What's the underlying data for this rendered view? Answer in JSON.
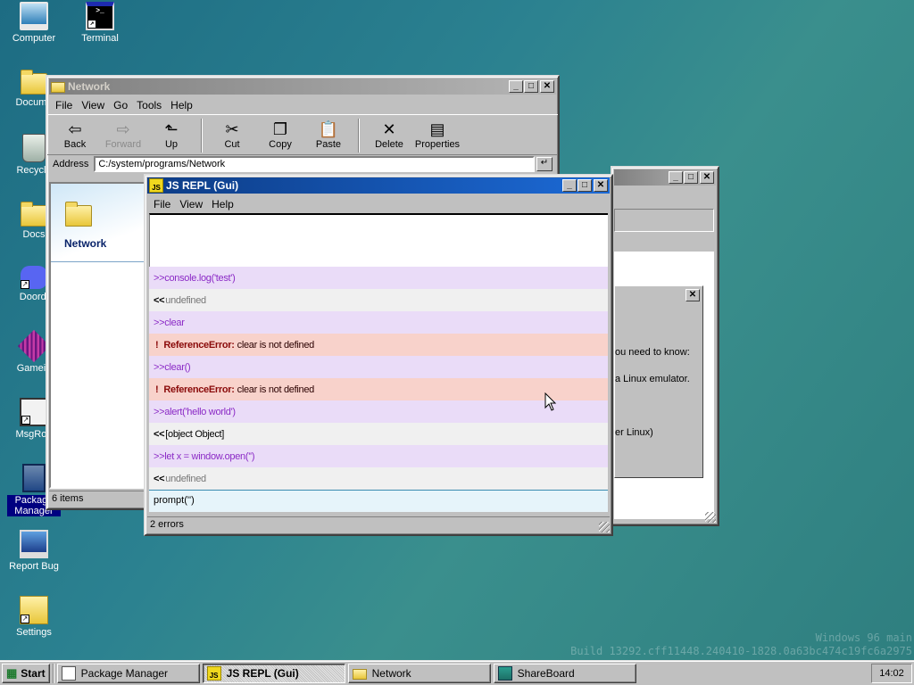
{
  "desktop": {
    "icons": [
      {
        "label": "Computer",
        "icon": "computer-icon"
      },
      {
        "label": "Terminal",
        "icon": "terminal-icon"
      },
      {
        "label": "Docume",
        "icon": "folder-icon"
      },
      {
        "label": "Recycle",
        "icon": "recycle-bin-icon"
      },
      {
        "label": "Docs",
        "icon": "folder-icon"
      },
      {
        "label": "Doordi",
        "icon": "discord-icon"
      },
      {
        "label": "Gamein",
        "icon": "game-icon"
      },
      {
        "label": "MsgRoo",
        "icon": "message-icon"
      },
      {
        "label": "Package Manager",
        "icon": "package-icon"
      },
      {
        "label": "Report Bug",
        "icon": "bug-report-icon"
      },
      {
        "label": "Settings",
        "icon": "settings-icon"
      }
    ],
    "watermark": {
      "line1": "Windows 96 main",
      "line2": "Build 13292.cff11448.240410-1828.0a63bc474c19fc6a2975"
    }
  },
  "explorer": {
    "title": "Network",
    "menu": [
      "File",
      "View",
      "Go",
      "Tools",
      "Help"
    ],
    "toolbar": [
      {
        "label": "Back",
        "icon": "back-arrow-icon",
        "glyph": "⇦"
      },
      {
        "label": "Forward",
        "icon": "forward-arrow-icon",
        "glyph": "⇨"
      },
      {
        "label": "Up",
        "icon": "up-folder-icon",
        "glyph": "⬑"
      },
      {
        "label": "Cut",
        "icon": "scissors-icon",
        "glyph": "✂"
      },
      {
        "label": "Copy",
        "icon": "copy-icon",
        "glyph": "❐"
      },
      {
        "label": "Paste",
        "icon": "paste-icon",
        "glyph": "📋"
      },
      {
        "label": "Delete",
        "icon": "delete-icon",
        "glyph": "✕"
      },
      {
        "label": "Properties",
        "icon": "properties-icon",
        "glyph": "▤"
      }
    ],
    "address_label": "Address",
    "address_value": "C:/system/programs/Network",
    "sidebar_title": "Network",
    "status": "6 items"
  },
  "background_window": {
    "lines": [
      "ou need to know:",
      "a Linux emulator.",
      "er Linux)"
    ]
  },
  "repl": {
    "title": "JS REPL (Gui)",
    "icon_text": "JS",
    "menu": [
      "File",
      "View",
      "Help"
    ],
    "entries": [
      {
        "type": "in",
        "prefix": ">>",
        "text": "console.log('test')"
      },
      {
        "type": "out",
        "prefix": "<<",
        "text": "undefined"
      },
      {
        "type": "in",
        "prefix": ">>",
        "text": "clear"
      },
      {
        "type": "err",
        "bang": "!",
        "error": "ReferenceError:",
        "text": "clear is not defined"
      },
      {
        "type": "in",
        "prefix": ">>",
        "text": "clear()"
      },
      {
        "type": "err",
        "bang": "!",
        "error": "ReferenceError:",
        "text": "clear is not defined"
      },
      {
        "type": "in",
        "prefix": ">>",
        "text": "alert('hello world')"
      },
      {
        "type": "out",
        "prefix": "<<",
        "text": "[object Object]",
        "strong": true
      },
      {
        "type": "in",
        "prefix": ">>",
        "text": "let x = window.open('')"
      },
      {
        "type": "out",
        "prefix": "<<",
        "text": "undefined"
      }
    ],
    "input_value": "prompt('')",
    "status": "2 errors"
  },
  "taskbar": {
    "start_label": "Start",
    "tasks": [
      {
        "label": "Package Manager",
        "icon": "package-icon",
        "active": false
      },
      {
        "label": "JS REPL (Gui)",
        "icon": "js-icon",
        "active": true
      },
      {
        "label": "Network",
        "icon": "folder-icon",
        "active": false
      },
      {
        "label": "ShareBoard",
        "icon": "shareboard-icon",
        "active": false
      }
    ],
    "clock": "14:02"
  }
}
